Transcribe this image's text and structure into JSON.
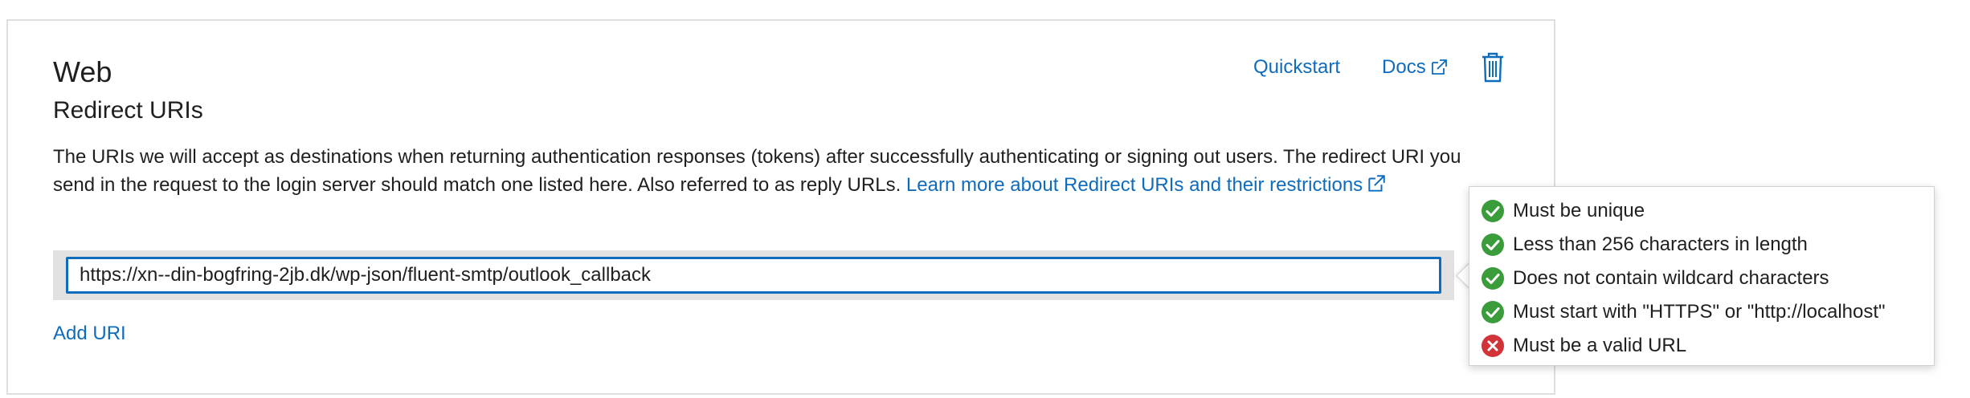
{
  "section": {
    "title": "Web",
    "subtitle": "Redirect URIs"
  },
  "header_actions": {
    "quickstart_label": "Quickstart",
    "docs_label": "Docs",
    "docs_icon": "external-link-icon",
    "delete_icon": "trash-icon"
  },
  "description": {
    "text": "The URIs we will accept as destinations when returning authentication responses (tokens) after successfully authenticating or signing out users. The redirect URI you send in the request to the login server should match one listed here. Also referred to as reply URLs. ",
    "link_text": "Learn more about Redirect URIs and their restrictions",
    "link_icon": "external-link-icon"
  },
  "redirect_uri": {
    "value": "https://xn--din-bogfring-2jb.dk/wp-json/fluent-smtp/outlook_callback"
  },
  "add_uri_label": "Add URI",
  "validation": {
    "rules": [
      {
        "text": "Must be unique",
        "status": "pass",
        "icon": "check-circle-icon"
      },
      {
        "text": "Less than 256 characters in length",
        "status": "pass",
        "icon": "check-circle-icon"
      },
      {
        "text": "Does not contain wildcard characters",
        "status": "pass",
        "icon": "check-circle-icon"
      },
      {
        "text": "Must start with \"HTTPS\" or \"http://localhost\"",
        "status": "pass",
        "icon": "check-circle-icon"
      },
      {
        "text": "Must be a valid URL",
        "status": "fail",
        "icon": "error-circle-icon"
      }
    ]
  },
  "colors": {
    "link": "#0f6cbd",
    "pass": "#3a9c3a",
    "fail": "#d13438",
    "input_border": "#0f6cbd",
    "row_background": "#e1e1e1"
  }
}
